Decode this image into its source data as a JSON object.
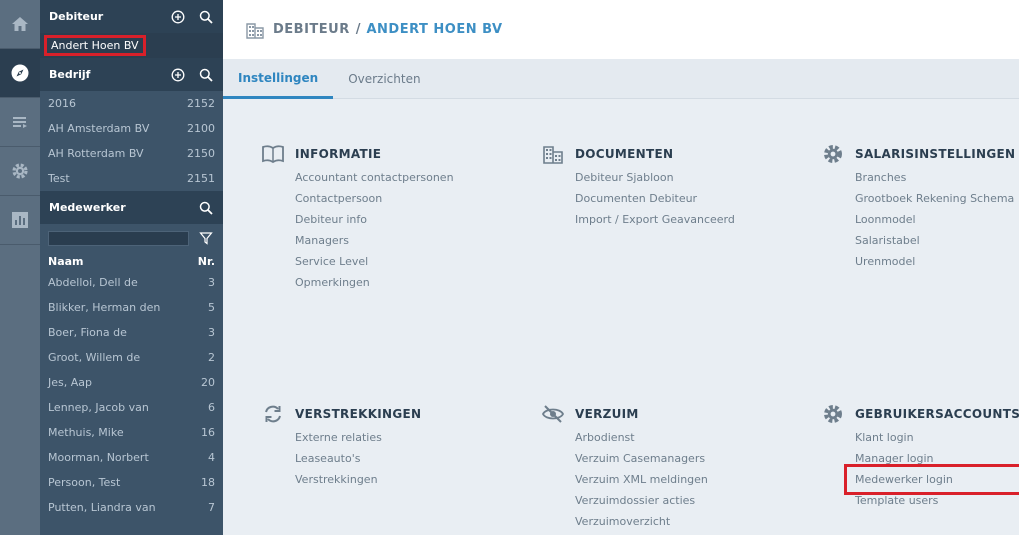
{
  "rail": {
    "items": [
      {
        "name": "home-icon",
        "active": false
      },
      {
        "name": "compass-icon",
        "active": true
      },
      {
        "name": "list-icon",
        "active": false
      },
      {
        "name": "gear-icon",
        "active": false
      },
      {
        "name": "bar-chart-icon",
        "active": false
      }
    ]
  },
  "sidebar": {
    "debiteur": {
      "title": "Debiteur",
      "selected": "Andert Hoen BV"
    },
    "bedrijf": {
      "title": "Bedrijf",
      "items": [
        {
          "label": "2016",
          "value": "2152"
        },
        {
          "label": "AH Amsterdam BV",
          "value": "2100"
        },
        {
          "label": "AH Rotterdam BV",
          "value": "2150"
        },
        {
          "label": "Test",
          "value": "2151"
        }
      ]
    },
    "medewerker": {
      "title": "Medewerker",
      "filter_value": "",
      "col_name": "Naam",
      "col_nr": "Nr.",
      "items": [
        {
          "label": "Abdelloi, Dell de",
          "value": "3"
        },
        {
          "label": "Blikker, Herman den",
          "value": "5"
        },
        {
          "label": "Boer, Fiona de",
          "value": "3"
        },
        {
          "label": "Groot, Willem de",
          "value": "2"
        },
        {
          "label": "Jes, Aap",
          "value": "20"
        },
        {
          "label": "Lennep, Jacob van",
          "value": "6"
        },
        {
          "label": "Methuis, Mike",
          "value": "16"
        },
        {
          "label": "Moorman, Norbert",
          "value": "4"
        },
        {
          "label": "Persoon, Test",
          "value": "18"
        },
        {
          "label": "Putten, Liandra van",
          "value": "7"
        }
      ]
    }
  },
  "header": {
    "crumb_a": "DEBITEUR",
    "separator": "/",
    "crumb_b": "ANDERT HOEN BV"
  },
  "tabs": [
    {
      "label": "Instellingen",
      "active": true
    },
    {
      "label": "Overzichten",
      "active": false
    }
  ],
  "cards": {
    "informatie": {
      "title": "INFORMATIE",
      "icon": "book-icon",
      "links": [
        "Accountant contactpersonen",
        "Contactpersoon",
        "Debiteur info",
        "Managers",
        "Service Level",
        "Opmerkingen"
      ]
    },
    "documenten": {
      "title": "DOCUMENTEN",
      "icon": "building-icon",
      "links": [
        "Debiteur Sjabloon",
        "Documenten Debiteur",
        "Import / Export Geavanceerd"
      ]
    },
    "salaris": {
      "title": "SALARISINSTELLINGEN",
      "icon": "gear-icon",
      "links": [
        "Branches",
        "Grootboek Rekening Schema",
        "Loonmodel",
        "Salaristabel",
        "Urenmodel"
      ]
    },
    "verstrekkingen": {
      "title": "VERSTREKKINGEN",
      "icon": "refresh-icon",
      "links": [
        "Externe relaties",
        "Leaseauto's",
        "Verstrekkingen"
      ]
    },
    "verzuim": {
      "title": "VERZUIM",
      "icon": "eye-slash-icon",
      "links": [
        "Arbodienst",
        "Verzuim Casemanagers",
        "Verzuim XML meldingen",
        "Verzuimdossier acties",
        "Verzuimoverzicht"
      ]
    },
    "gebruikers": {
      "title": "GEBRUIKERSACCOUNTS",
      "icon": "gear-icon",
      "links": [
        "Klant login",
        "Manager login",
        "Medewerker login",
        "Template users"
      ]
    }
  },
  "colors": {
    "accent": "#2f86c0",
    "highlight": "#d9202a",
    "sidebar": "#3d5469",
    "rail": "#5b6e80"
  }
}
